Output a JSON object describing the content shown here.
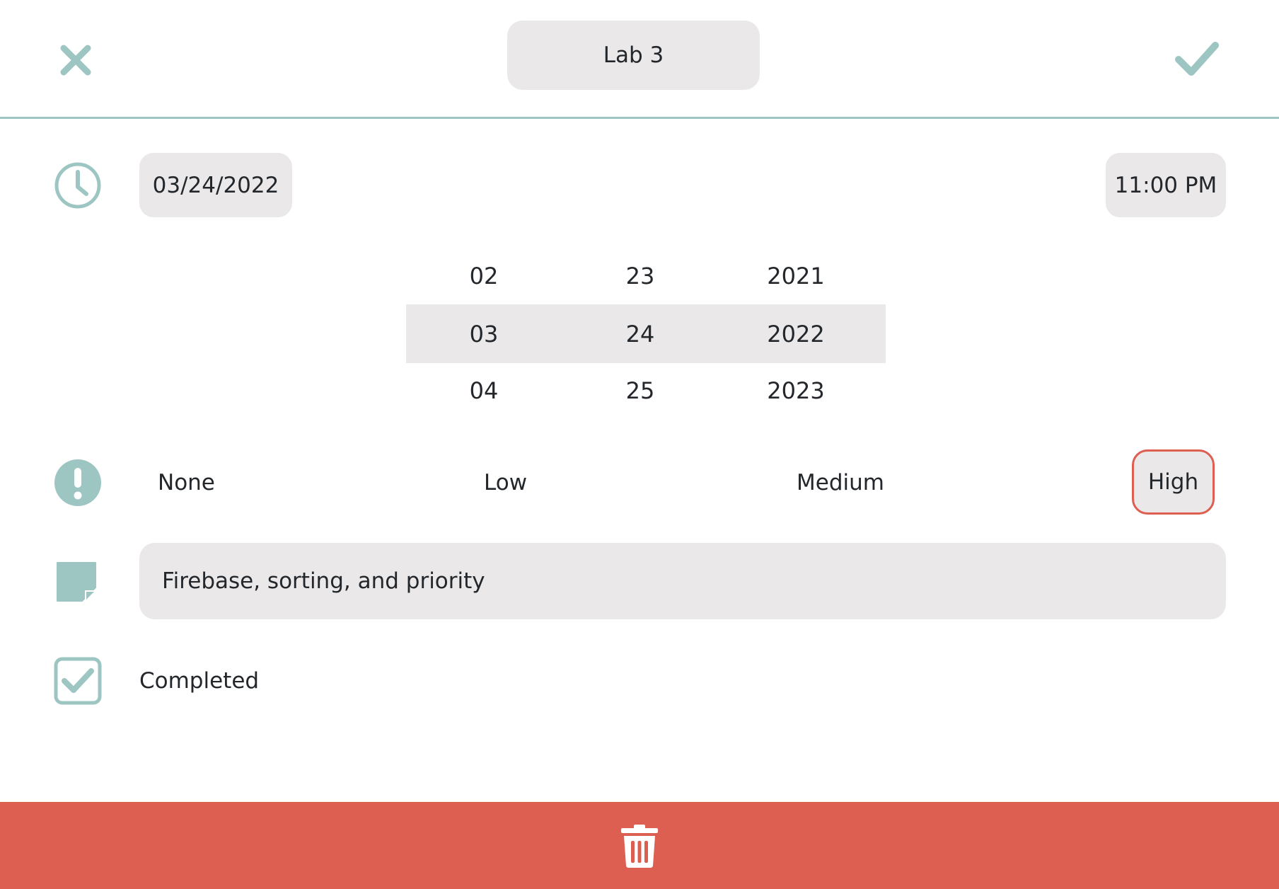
{
  "header": {
    "title": "Lab 3",
    "close_icon": "x-icon",
    "confirm_icon": "checkmark-icon"
  },
  "schedule": {
    "date": "03/24/2022",
    "time": "11:00 PM",
    "icon": "clock-icon"
  },
  "date_picker": {
    "rows": [
      {
        "month": "02",
        "day": "23",
        "year": "2021"
      },
      {
        "month": "03",
        "day": "24",
        "year": "2022"
      },
      {
        "month": "04",
        "day": "25",
        "year": "2023"
      }
    ],
    "selected_row": 1
  },
  "priority": {
    "icon": "exclamation-icon",
    "options": [
      "None",
      "Low",
      "Medium",
      "High"
    ],
    "selected": "High"
  },
  "notes": {
    "icon": "sticky-note-icon",
    "value": "Firebase, sorting, and priority"
  },
  "completed": {
    "label": "Completed",
    "checked": true
  },
  "delete": {
    "icon": "trash-icon"
  },
  "colors": {
    "accent": "#9dc5c2",
    "danger": "#dc5f52",
    "pill_bg": "#eae8e9",
    "text": "#23272b"
  }
}
